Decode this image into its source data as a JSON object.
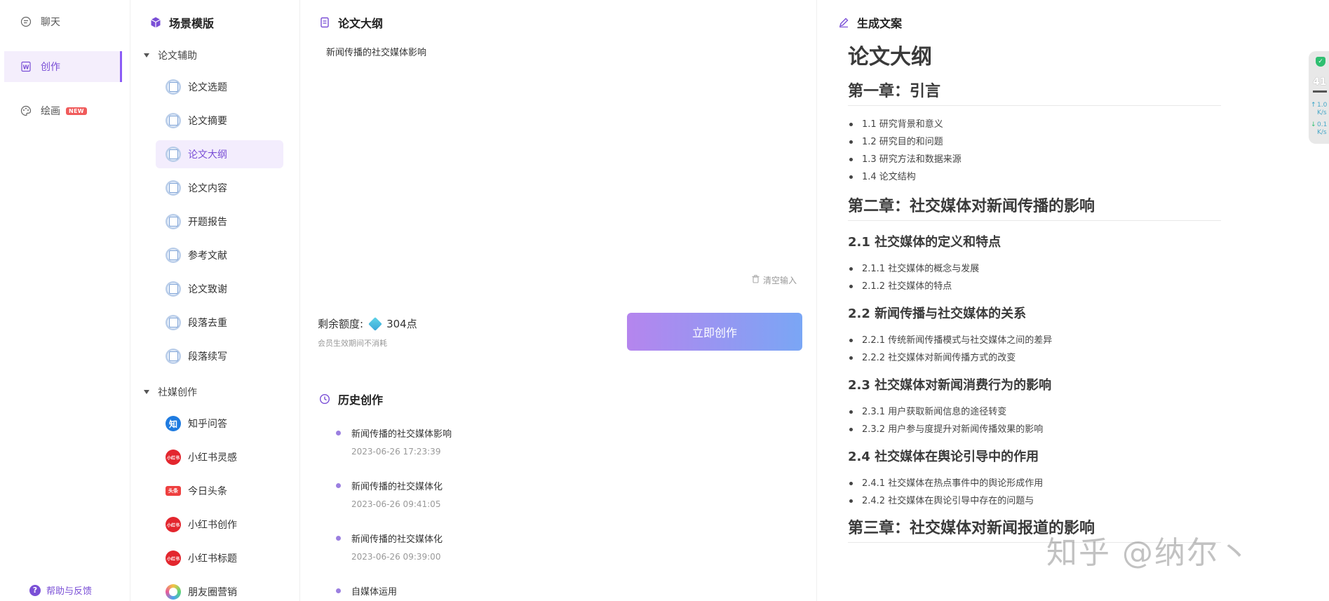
{
  "nav": {
    "items": [
      {
        "label": "聊天",
        "icon": "chat-bubble-icon"
      },
      {
        "label": "创作",
        "icon": "word-doc-icon"
      },
      {
        "label": "绘画",
        "icon": "palette-icon",
        "badge": "NEW"
      }
    ],
    "help": "帮助与反馈"
  },
  "templates": {
    "title": "场景模版",
    "groups": [
      {
        "label": "论文辅助",
        "items": [
          "论文选题",
          "论文摘要",
          "论文大纲",
          "论文内容",
          "开题报告",
          "参考文献",
          "论文致谢",
          "段落去重",
          "段落续写"
        ]
      },
      {
        "label": "社媒创作",
        "items": [
          "知乎问答",
          "小红书灵感",
          "今日头条",
          "小红书创作",
          "小红书标题",
          "朋友圈营销"
        ]
      }
    ],
    "icon_texts": {
      "zhihu": "知",
      "xhs": "小红书",
      "toutiao": "头条"
    }
  },
  "input_panel": {
    "title": "论文大纲",
    "topic": "新闻传播的社交媒体影响",
    "clear_label": "清空输入",
    "quota_label": "剩余额度:",
    "quota_value": "304点",
    "quota_note": "会员生效期间不消耗",
    "submit_label": "立即创作"
  },
  "history": {
    "title": "历史创作",
    "items": [
      {
        "title": "新闻传播的社交媒体影响",
        "time": "2023-06-26 17:23:39"
      },
      {
        "title": "新闻传播的社交媒体化",
        "time": "2023-06-26 09:41:05"
      },
      {
        "title": "新闻传播的社交媒体化",
        "time": "2023-06-26 09:39:00"
      },
      {
        "title": "自媒体运用",
        "time": ""
      }
    ]
  },
  "output": {
    "title": "生成文案",
    "doc_title": "论文大纲",
    "ch1": {
      "heading": "第一章：引言",
      "items": [
        "1.1 研究背景和意义",
        "1.2 研究目的和问题",
        "1.3 研究方法和数据来源",
        "1.4 论文结构"
      ]
    },
    "ch2": {
      "heading": "第二章：社交媒体对新闻传播的影响",
      "sections": [
        {
          "heading": "2.1 社交媒体的定义和特点",
          "items": [
            "2.1.1 社交媒体的概念与发展",
            "2.1.2 社交媒体的特点"
          ]
        },
        {
          "heading": "2.2 新闻传播与社交媒体的关系",
          "items": [
            "2.2.1 传统新闻传播模式与社交媒体之间的差异",
            "2.2.2 社交媒体对新闻传播方式的改变"
          ]
        },
        {
          "heading": "2.3 社交媒体对新闻消费行为的影响",
          "items": [
            "2.3.1 用户获取新闻信息的途径转变",
            "2.3.2 用户参与度提升对新闻传播效果的影响"
          ]
        },
        {
          "heading": "2.4 社交媒体在舆论引导中的作用",
          "items": [
            "2.4.1 社交媒体在热点事件中的舆论形成作用",
            "2.4.2 社交媒体在舆论引导中存在的问题与"
          ]
        }
      ]
    },
    "ch3": {
      "heading": "第三章：社交媒体对新闻报道的影响"
    }
  },
  "widget": {
    "value": "41",
    "up": "1.0",
    "down": "0.1",
    "unit": "K/s"
  },
  "watermark": "知乎 @纳尔丶"
}
